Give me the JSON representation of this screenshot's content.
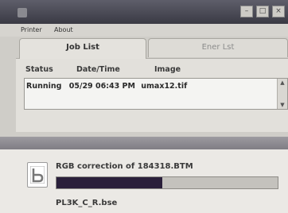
{
  "menu": {
    "items": [
      "Printer",
      "About"
    ]
  },
  "tabs": [
    {
      "label": "Job List",
      "active": true
    },
    {
      "label": "Ener Lst",
      "active": false
    }
  ],
  "job_list": {
    "columns": [
      "Status",
      "Date/Time",
      "Image"
    ],
    "rows": [
      {
        "status": "Running",
        "datetime": "05/29 06:43 PM",
        "image": "umax12.tif"
      }
    ]
  },
  "progress": {
    "status_text": "RGB correction of 184318.BTM",
    "percent": 48,
    "file_name": "PL3K_C_R.bse",
    "fill_color": "#2a1f3a"
  },
  "colors": {
    "titlebar": "#4a4a55",
    "panel": "#e2e0db",
    "progress_header": "#8e8c92"
  },
  "icons": {
    "app": "app-icon",
    "step": "document-b-icon"
  }
}
